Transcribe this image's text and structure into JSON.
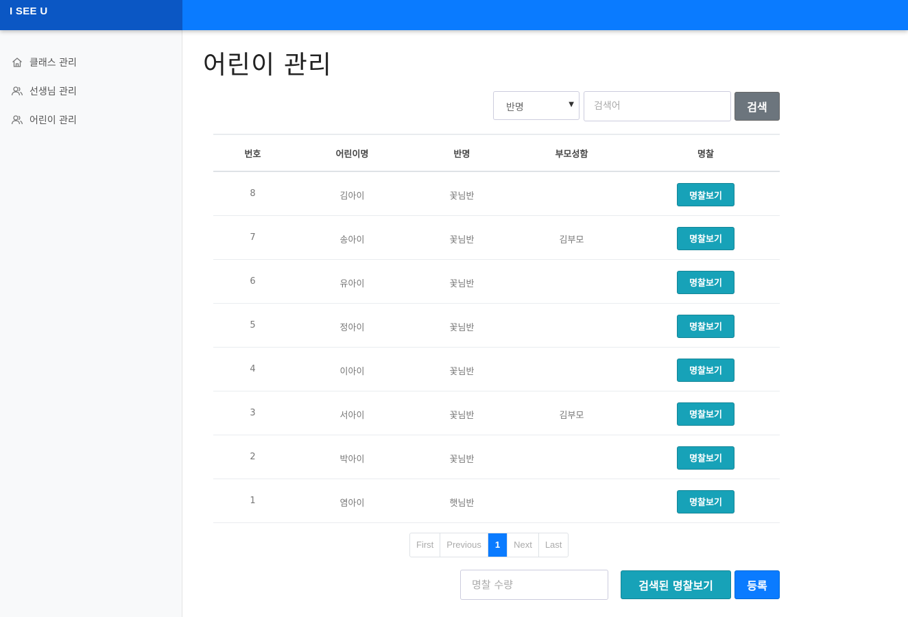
{
  "brand": "I SEE U",
  "sidebar": {
    "items": [
      {
        "label": "클래스 관리",
        "icon": "home-icon"
      },
      {
        "label": "선생님 관리",
        "icon": "users-icon"
      },
      {
        "label": "어린이 관리",
        "icon": "users-icon"
      }
    ]
  },
  "page": {
    "title": "어린이 관리"
  },
  "search": {
    "class_select_value": "반명",
    "keyword_placeholder": "검색어",
    "button_label": "검색"
  },
  "table": {
    "headers": [
      "번호",
      "어린이명",
      "반명",
      "부모성함",
      "명찰"
    ],
    "rows": [
      {
        "no": "8",
        "child": "김아이",
        "cls": "꽃님반",
        "parent": "",
        "action": "명찰보기"
      },
      {
        "no": "7",
        "child": "송아이",
        "cls": "꽃님반",
        "parent": "김부모",
        "action": "명찰보기"
      },
      {
        "no": "6",
        "child": "유아이",
        "cls": "꽃님반",
        "parent": "",
        "action": "명찰보기"
      },
      {
        "no": "5",
        "child": "정아이",
        "cls": "꽃님반",
        "parent": "",
        "action": "명찰보기"
      },
      {
        "no": "4",
        "child": "이아이",
        "cls": "꽃님반",
        "parent": "",
        "action": "명찰보기"
      },
      {
        "no": "3",
        "child": "서아이",
        "cls": "꽃님반",
        "parent": "김부모",
        "action": "명찰보기"
      },
      {
        "no": "2",
        "child": "박아이",
        "cls": "꽃님반",
        "parent": "",
        "action": "명찰보기"
      },
      {
        "no": "1",
        "child": "염아이",
        "cls": "햇님반",
        "parent": "",
        "action": "명찰보기"
      }
    ]
  },
  "pagination": {
    "first": "First",
    "previous": "Previous",
    "current": "1",
    "next": "Next",
    "last": "Last"
  },
  "footer": {
    "qty_placeholder": "명찰 수량",
    "view_searched_label": "검색된 명찰보기",
    "register_label": "등록"
  },
  "colors": {
    "topbar": "#0a7bff",
    "brand_bg": "#0b57c4",
    "teal": "#17a2b8",
    "gray": "#6c757d",
    "blue": "#0a7bff"
  }
}
